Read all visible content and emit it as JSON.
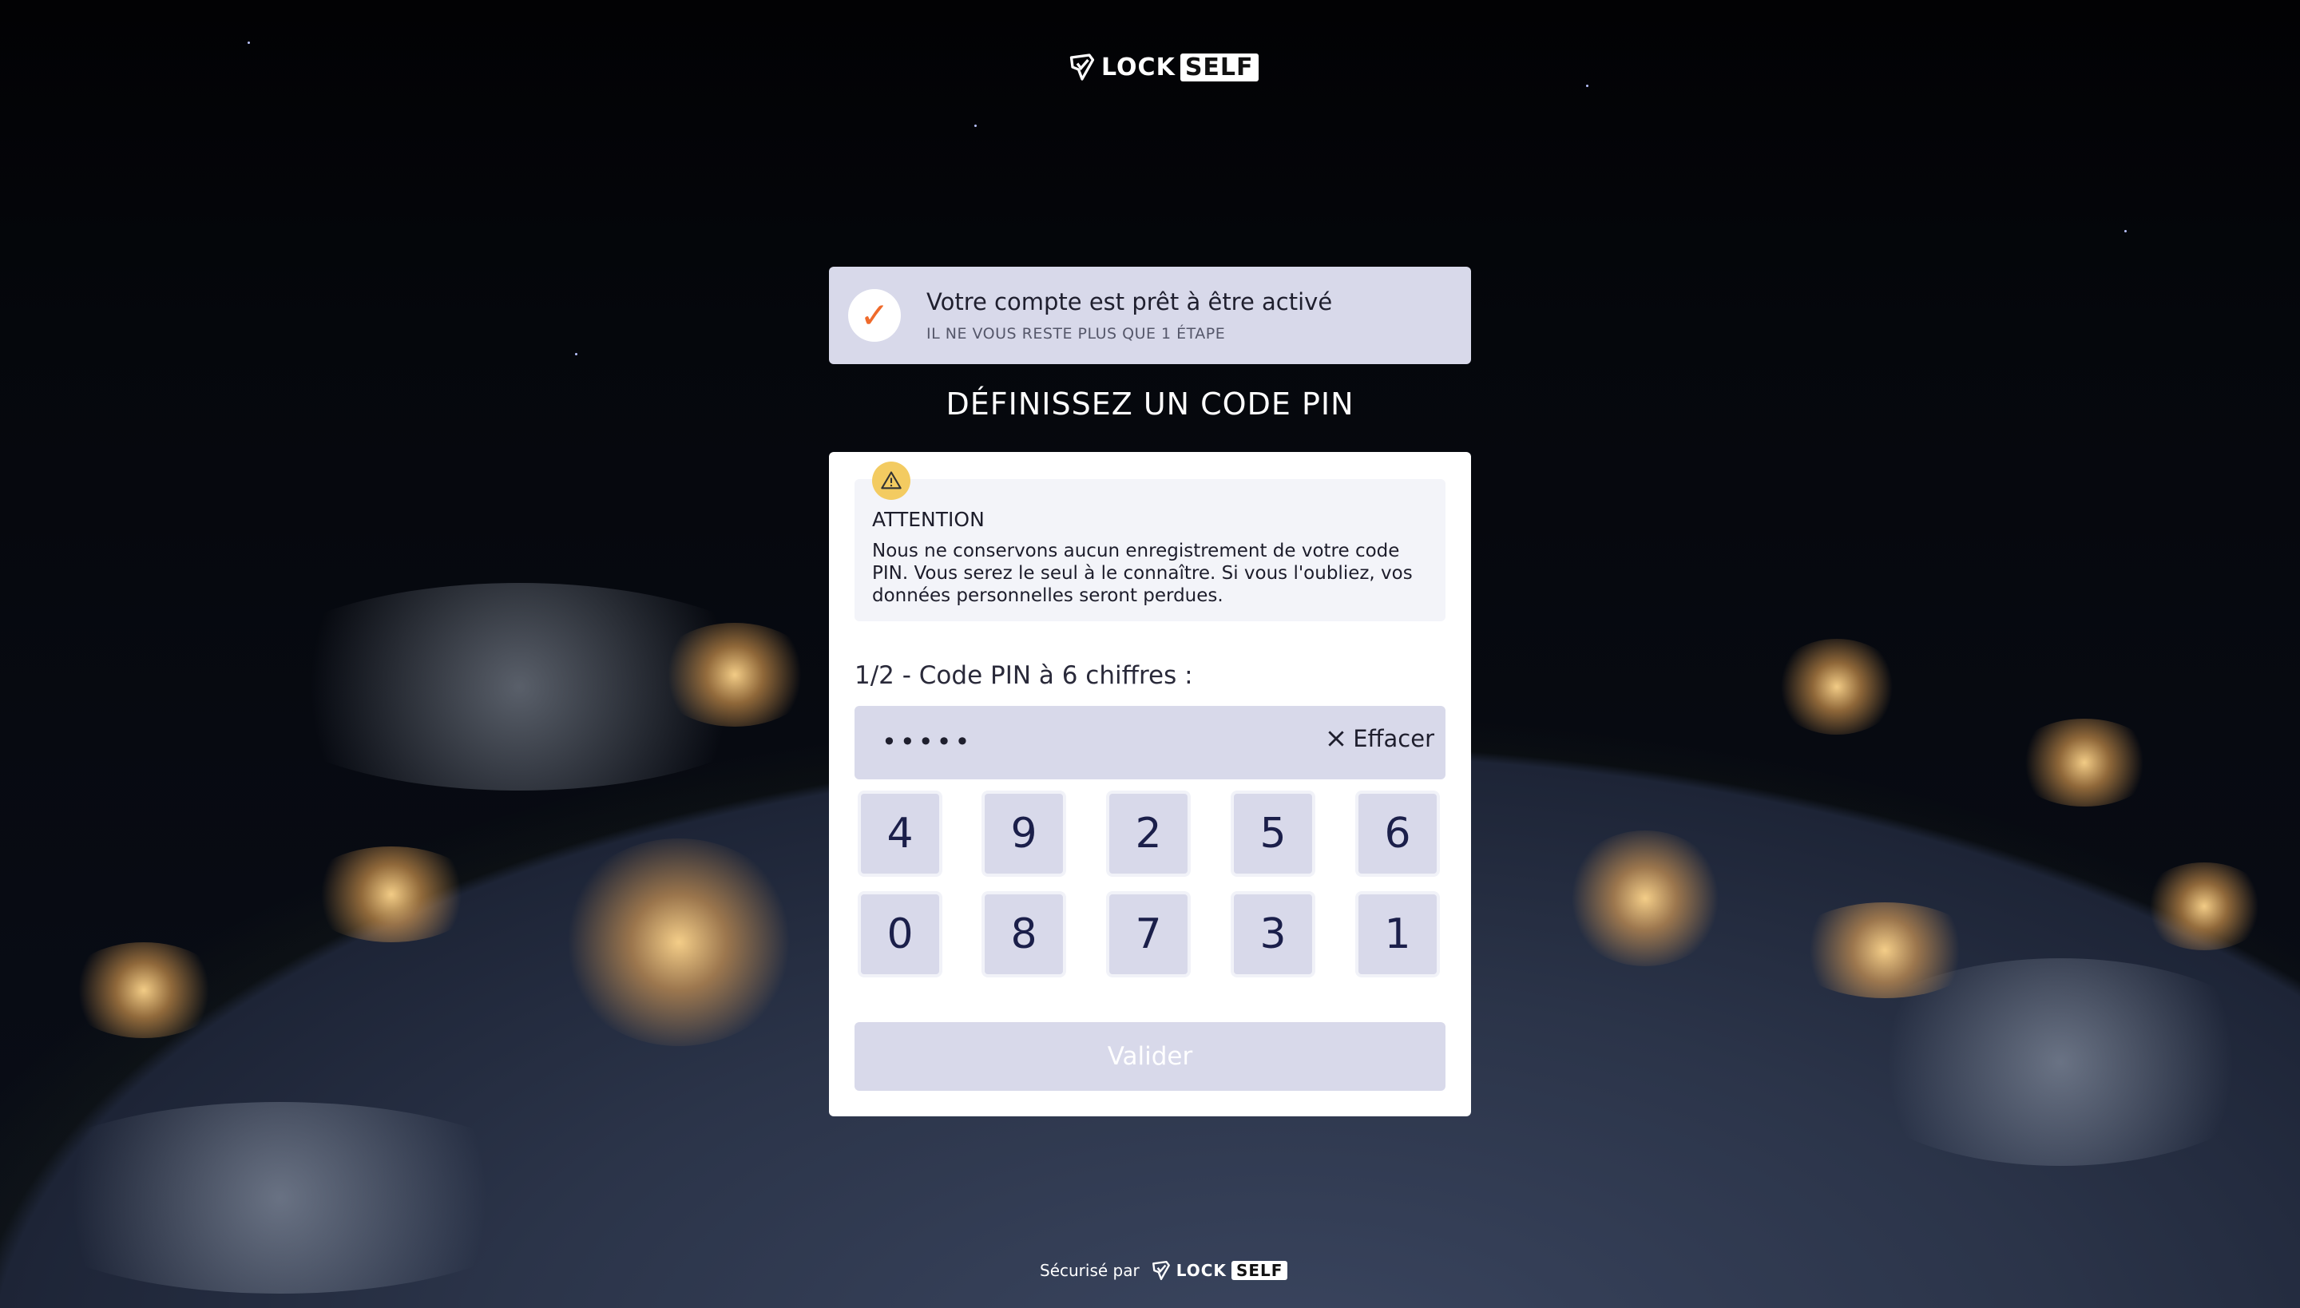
{
  "brand": {
    "name_part1": "LOCK",
    "name_part2": "SELF"
  },
  "banner": {
    "title": "Votre compte est prêt à être activé",
    "subtitle": "IL NE VOUS RESTE PLUS QUE 1 ÉTAPE",
    "check_symbol": "✓"
  },
  "heading": "DÉFINISSEZ UN CODE PIN",
  "warning": {
    "title": "ATTENTION",
    "text": "Nous ne conservons aucun enregistrement de votre code PIN. Vous serez le seul à le connaître. Si vous l'oubliez, vos données personnelles seront perdues."
  },
  "pin": {
    "label": "1/2 - Code PIN à 6 chiffres :",
    "masked_value": "•••••",
    "clear_label": "Effacer"
  },
  "keypad": {
    "keys": [
      "4",
      "9",
      "2",
      "5",
      "6",
      "0",
      "8",
      "7",
      "3",
      "1"
    ]
  },
  "validate_label": "Valider",
  "footer": {
    "secured_by": "Sécurisé par"
  },
  "colors": {
    "accent": "#ef6a2b",
    "panel": "#d8d9ea",
    "warning": "#f3cb61",
    "key_text": "#1b1f4a"
  }
}
